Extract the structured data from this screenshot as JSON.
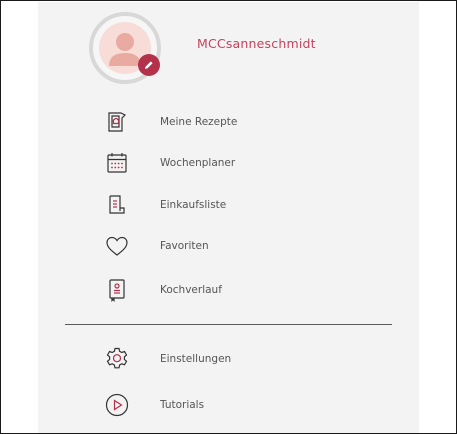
{
  "profile": {
    "username": "MCCsanneschmidt"
  },
  "menu": {
    "items": [
      {
        "id": "meine-rezepte",
        "label": "Meine Rezepte",
        "icon": "recipe-book-icon"
      },
      {
        "id": "wochenplaner",
        "label": "Wochenplaner",
        "icon": "calendar-icon"
      },
      {
        "id": "einkaufsliste",
        "label": "Einkaufsliste",
        "icon": "shopping-list-icon"
      },
      {
        "id": "favoriten",
        "label": "Favoriten",
        "icon": "heart-icon"
      },
      {
        "id": "kochverlauf",
        "label": "Kochverlauf",
        "icon": "cooking-history-icon"
      }
    ],
    "secondary": [
      {
        "id": "einstellungen",
        "label": "Einstellungen",
        "icon": "gear-icon"
      },
      {
        "id": "tutorials",
        "label": "Tutorials",
        "icon": "play-icon"
      }
    ]
  },
  "colors": {
    "accent": "#b4314c",
    "username": "#c4435e",
    "panel_bg": "#f3f3f3",
    "text": "#555555"
  }
}
